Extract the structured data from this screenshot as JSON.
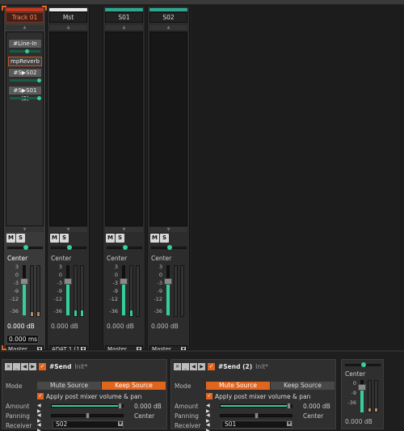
{
  "channels": [
    {
      "name": "Track 01",
      "color": "#c5371f",
      "selected": true,
      "pan": "Center",
      "level": "0.000 dB",
      "delay": "0.000 ms",
      "output": "Master",
      "processors": [
        {
          "type": "send",
          "label": "#Line-In",
          "level": 0.55
        },
        {
          "type": "plugin",
          "label": "mpReverb"
        },
        {
          "type": "send",
          "label": "#S▶S02",
          "level": 0.95
        },
        {
          "type": "send",
          "label": "#S▶S01 (2)",
          "level": 0.95
        }
      ]
    },
    {
      "name": "Mst",
      "color": "#e8e8e8",
      "selected": false,
      "pan": "Center",
      "level": "0.000 dB",
      "output": "ADAT 1 (1) &..."
    },
    {
      "name": "S01",
      "color": "#2fa58e",
      "selected": false,
      "pan": "Center",
      "level": "0.000 dB",
      "output": "Master"
    },
    {
      "name": "S02",
      "color": "#2fa58e",
      "selected": false,
      "pan": "Center",
      "level": "0.000 dB",
      "output": "Master"
    }
  ],
  "common": {
    "mute": "M",
    "solo": "S",
    "scale": [
      "3",
      "0",
      "-3",
      "-9",
      "-12",
      "-18",
      "-36"
    ]
  },
  "sends": [
    {
      "name": "#Send",
      "preset": "Init*",
      "mode_label": "Mode",
      "mode_options": [
        "Mute Source",
        "Keep Source"
      ],
      "mode_selected": "Keep Source",
      "post_mixer": "Apply post mixer volume & pan",
      "amount_label": "Amount",
      "amount": "0.000 dB",
      "panning_label": "Panning",
      "panning": "Center",
      "receiver_label": "Receiver",
      "receiver": "S02"
    },
    {
      "name": "#Send (2)",
      "preset": "Init*",
      "mode_label": "Mode",
      "mode_options": [
        "Mute Source",
        "Keep Source"
      ],
      "mode_selected": "Mute Source",
      "post_mixer": "Apply post mixer volume & pan",
      "amount_label": "Amount",
      "amount": "0.000 dB",
      "panning_label": "Panning",
      "panning": "Center",
      "receiver_label": "Receiver",
      "receiver": "S01"
    }
  ],
  "mini_strip": {
    "pan": "Center",
    "scale": [
      "0",
      "-9",
      "-36"
    ],
    "level": "0.000 dB"
  },
  "colors": {
    "accent": "#e0651f",
    "fader": "#35d09a",
    "selected_track": "#c5371f",
    "send_track": "#2fa58e"
  }
}
